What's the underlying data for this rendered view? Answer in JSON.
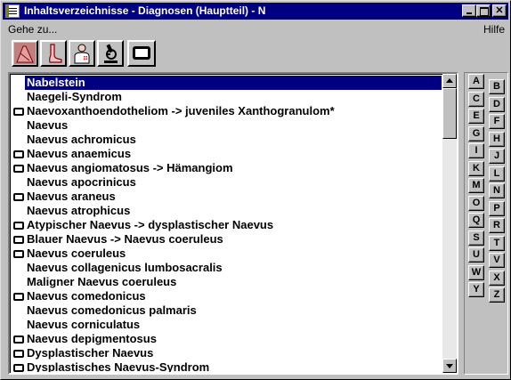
{
  "window": {
    "title": "Inhaltsverzeichnisse - Diagnosen (Hauptteil) - N",
    "close_glyph": "✕"
  },
  "menu": {
    "goto": "Gehe zu...",
    "help": "Hilfe"
  },
  "toolbar": [
    {
      "icon": "body-region-icon"
    },
    {
      "icon": "foot-icon"
    },
    {
      "icon": "doctor-icon"
    },
    {
      "icon": "microscope-icon"
    },
    {
      "icon": "monitor-icon"
    }
  ],
  "list": {
    "rows": [
      {
        "text": "Nabelstein",
        "icon": false,
        "selected": true
      },
      {
        "text": "Naegeli-Syndrom",
        "icon": false
      },
      {
        "text": "Naevoxanthoendotheliom  ->  juveniles Xanthogranulom*",
        "icon": true
      },
      {
        "text": "Naevus",
        "icon": false
      },
      {
        "text": "Naevus achromicus",
        "icon": false
      },
      {
        "text": "Naevus anaemicus",
        "icon": true
      },
      {
        "text": "Naevus angiomatosus  ->  Hämangiom",
        "icon": true
      },
      {
        "text": "Naevus apocrinicus",
        "icon": false
      },
      {
        "text": "Naevus araneus",
        "icon": true
      },
      {
        "text": "Naevus atrophicus",
        "icon": false
      },
      {
        "text": "Atypischer Naevus  ->  dysplastischer Naevus",
        "icon": true
      },
      {
        "text": "Blauer Naevus  ->  Naevus coeruleus",
        "icon": true
      },
      {
        "text": "Naevus coeruleus",
        "icon": true
      },
      {
        "text": "Naevus collagenicus lumbosacralis",
        "icon": false
      },
      {
        "text": "Maligner Naevus coeruleus",
        "icon": false
      },
      {
        "text": "Naevus comedonicus",
        "icon": true
      },
      {
        "text": "Naevus comedonicus palmaris",
        "icon": false
      },
      {
        "text": "Naevus corniculatus",
        "icon": false
      },
      {
        "text": "Naevus depigmentosus",
        "icon": true
      },
      {
        "text": "Dysplastischer Naevus",
        "icon": true
      },
      {
        "text": "Dysplastisches Naevus-Syndrom",
        "icon": true
      }
    ]
  },
  "letters": {
    "left": [
      "A",
      "C",
      "E",
      "G",
      "I",
      "K",
      "M",
      "O",
      "Q",
      "S",
      "U",
      "W",
      "Y"
    ],
    "right": [
      "B",
      "D",
      "F",
      "H",
      "J",
      "L",
      "N",
      "P",
      "R",
      "T",
      "V",
      "X",
      "Z"
    ]
  }
}
